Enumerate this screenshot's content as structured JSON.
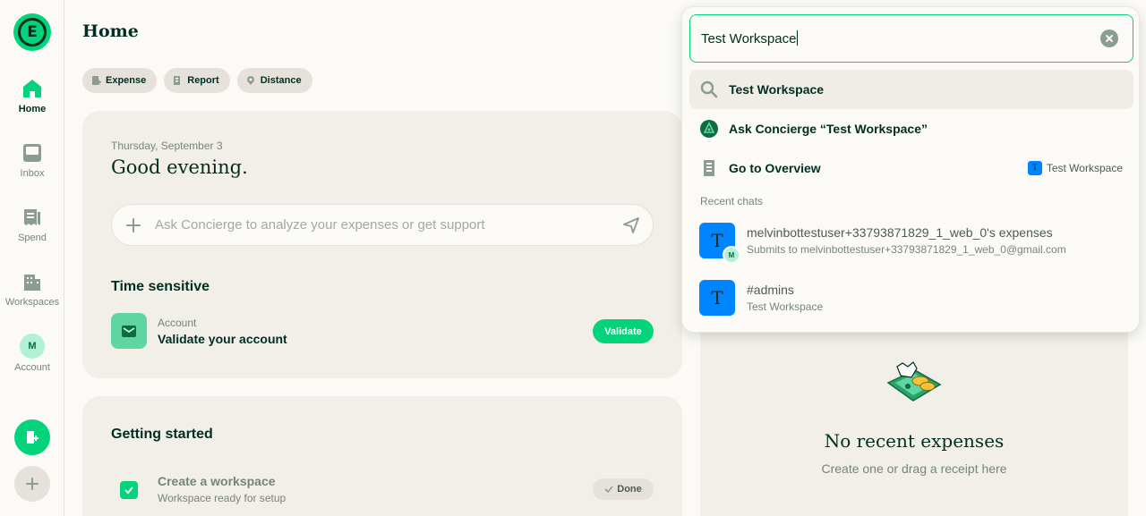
{
  "sidebar": {
    "logo_letter": "E",
    "items": [
      {
        "label": "Home",
        "icon": "home-icon"
      },
      {
        "label": "Inbox",
        "icon": "inbox-icon"
      },
      {
        "label": "Spend",
        "icon": "receipt-icon"
      },
      {
        "label": "Workspaces",
        "icon": "building-icon"
      },
      {
        "label": "Account",
        "icon": "avatar",
        "avatar_letter": "M"
      }
    ]
  },
  "header": {
    "title": "Home"
  },
  "quick_actions": [
    {
      "label": "Expense",
      "icon": "expense-icon"
    },
    {
      "label": "Report",
      "icon": "report-icon"
    },
    {
      "label": "Distance",
      "icon": "distance-icon"
    }
  ],
  "welcome": {
    "date": "Thursday, September 3",
    "greeting": "Good evening.",
    "ask_placeholder": "Ask Concierge to analyze your expenses or get support"
  },
  "time_sensitive": {
    "title": "Time sensitive",
    "task": {
      "kicker": "Account",
      "title": "Validate your account",
      "button": "Validate"
    }
  },
  "getting_started": {
    "title": "Getting started",
    "task": {
      "title": "Create a workspace",
      "subtitle": "Workspace ready for setup",
      "button": "Done"
    }
  },
  "empty_state": {
    "title": "No recent expenses",
    "subtitle": "Create one or drag a receipt here"
  },
  "search": {
    "value": "Test Workspace",
    "results": [
      {
        "label": "Test Workspace",
        "icon": "search-icon"
      },
      {
        "label": "Ask Concierge “Test Workspace”",
        "icon": "concierge-icon"
      },
      {
        "label": "Go to Overview",
        "icon": "building-icon",
        "context": "Test Workspace",
        "context_letter": "T"
      }
    ],
    "recent_label": "Recent chats",
    "recent_chats": [
      {
        "title": "melvinbottestuser+33793871829_1_web_0's expenses",
        "subtitle": "Submits to melvinbottestuser+33793871829_1_web_0@gmail.com",
        "avatar_letter": "T",
        "sub_avatar_letter": "M"
      },
      {
        "title": "#admins",
        "subtitle": "Test Workspace",
        "avatar_letter": "T"
      }
    ]
  },
  "colors": {
    "accent": "#03d47c",
    "brand_dark": "#002e22",
    "workspace_blue": "#0185ff"
  }
}
